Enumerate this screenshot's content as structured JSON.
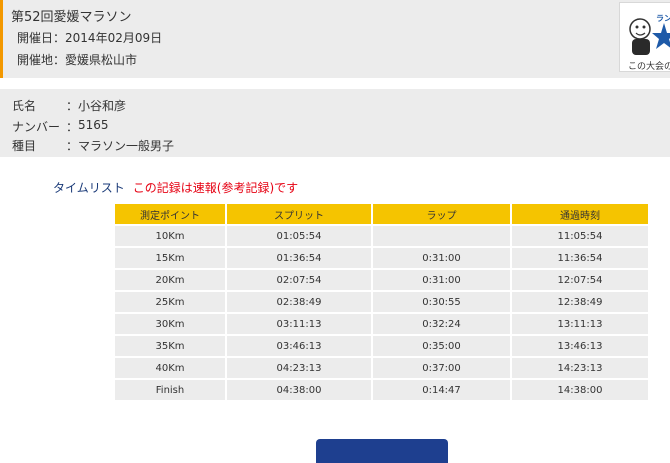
{
  "event": {
    "title": "第52回愛媛マラソン",
    "date_label": "開催日",
    "date_value": "2014年02月09日",
    "place_label": "開催地",
    "place_value": "愛媛県松山市",
    "badge_top_text": "ラン",
    "badge_caption": "この大会の"
  },
  "runner": {
    "name_label": "氏名",
    "name_value": "小谷和彦",
    "number_label": "ナンバー",
    "number_value": "5165",
    "category_label": "種目",
    "category_value": "マラソン一般男子",
    "separator": "："
  },
  "timelist": {
    "label": "タイムリスト",
    "note": "この記録は速報(参考記録)です",
    "headers": [
      "測定ポイント",
      "スプリット",
      "ラップ",
      "通過時刻"
    ],
    "rows": [
      [
        "10Km",
        "01:05:54",
        "",
        "11:05:54"
      ],
      [
        "15Km",
        "01:36:54",
        "0:31:00",
        "11:36:54"
      ],
      [
        "20Km",
        "02:07:54",
        "0:31:00",
        "12:07:54"
      ],
      [
        "25Km",
        "02:38:49",
        "0:30:55",
        "12:38:49"
      ],
      [
        "30Km",
        "03:11:13",
        "0:32:24",
        "13:11:13"
      ],
      [
        "35Km",
        "03:46:13",
        "0:35:00",
        "13:46:13"
      ],
      [
        "40Km",
        "04:23:13",
        "0:37:00",
        "14:23:13"
      ],
      [
        "Finish",
        "04:38:00",
        "0:14:47",
        "14:38:00"
      ]
    ]
  },
  "colors": {
    "accent_orange": "#f39800",
    "header_yellow": "#f5c400",
    "note_red": "#e60012",
    "label_navy": "#1a3a78",
    "button_blue": "#1e3f8f"
  }
}
